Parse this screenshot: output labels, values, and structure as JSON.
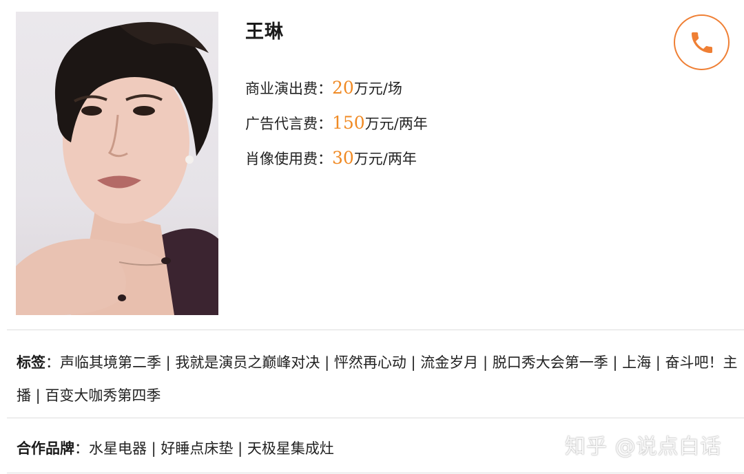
{
  "profile": {
    "name": "王琳",
    "fees": [
      {
        "label": "商业演出费：",
        "amount": "20",
        "unit": "万元/场"
      },
      {
        "label": "广告代言费：",
        "amount": "150",
        "unit": "万元/两年"
      },
      {
        "label": "肖像使用费：",
        "amount": "30",
        "unit": "万元/两年"
      }
    ]
  },
  "tags": {
    "label": "标签",
    "separator": "：",
    "text": "声临其境第二季 | 我就是演员之巅峰对决 | 怦然再心动 | 流金岁月 | 脱口秀大会第一季 | 上海 | 奋斗吧！主播 | 百变大咖秀第四季"
  },
  "brands": {
    "label": "合作品牌",
    "separator": "：",
    "text": "水星电器 | 好睡点床垫 | 天极星集成灶"
  },
  "watermark": "知乎 @说点白话",
  "colors": {
    "accent": "#f08a24",
    "call_button": "#ef7f34",
    "divider": "#dddddd"
  },
  "icons": {
    "call": "phone-icon"
  }
}
